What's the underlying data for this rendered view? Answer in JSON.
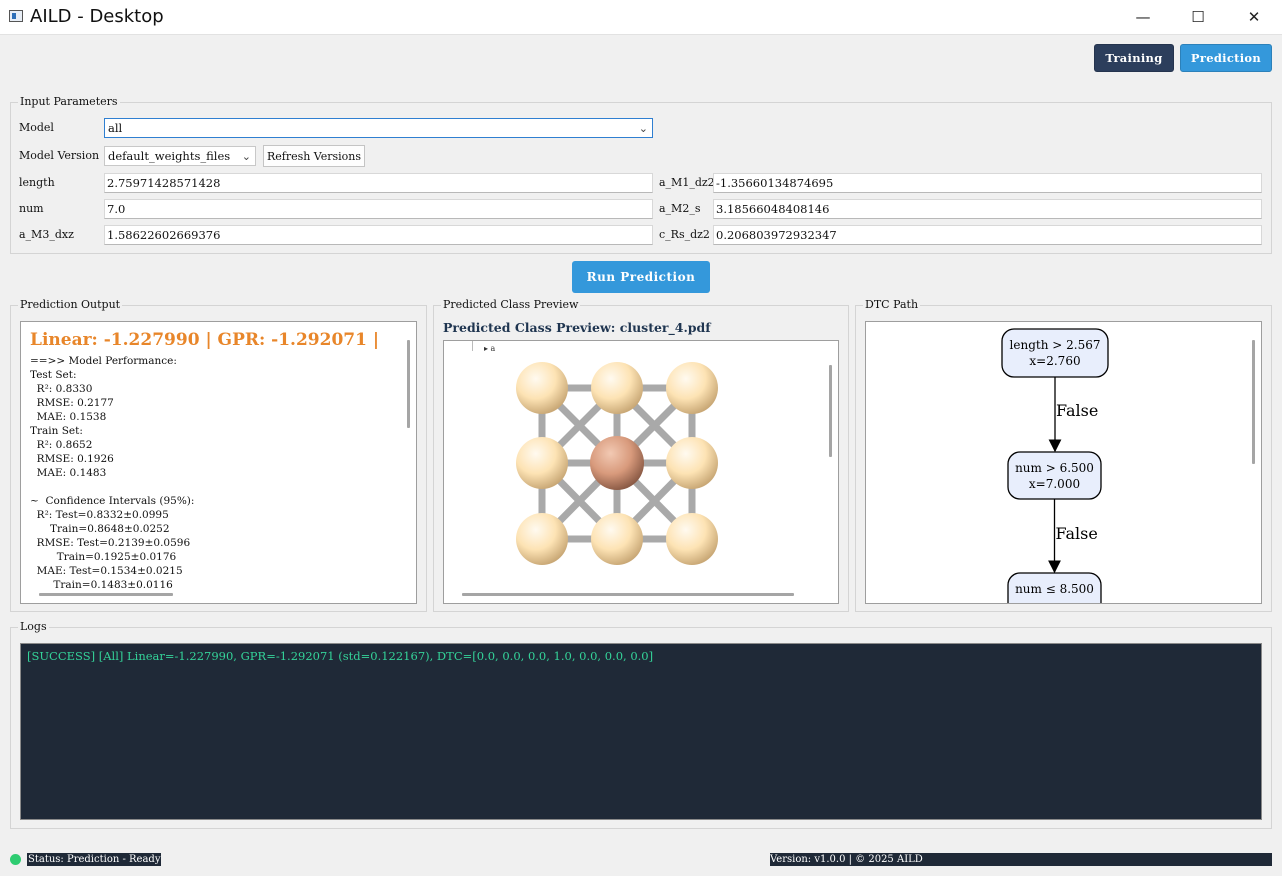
{
  "window": {
    "title": "AILD - Desktop",
    "minimize": "—",
    "maximize": "☐",
    "close": "✕"
  },
  "nav": {
    "training": "Training",
    "prediction": "Prediction",
    "training_color": "#2c3e5c",
    "prediction_color": "#3498db"
  },
  "input": {
    "group_title": "Input Parameters",
    "model_label": "Model",
    "model_value": "all",
    "version_label": "Model Version",
    "version_value": "default_weights_files",
    "refresh_label": "Refresh Versions",
    "fields": [
      {
        "label": "length",
        "value": "2.75971428571428"
      },
      {
        "label": "a_M1_dz2",
        "value": "-1.35660134874695"
      },
      {
        "label": "num",
        "value": "7.0"
      },
      {
        "label": "a_M2_s",
        "value": "3.18566048408146"
      },
      {
        "label": "a_M3_dxz",
        "value": "1.58622602669376"
      },
      {
        "label": "c_Rs_dz2",
        "value": "0.206803972932347"
      }
    ]
  },
  "run_label": "Run Prediction",
  "output": {
    "group_title": "Prediction Output",
    "headline": "Linear: -1.227990 | GPR: -1.292071 |",
    "headline_color": "#e8862a",
    "lines": [
      "==>> Model Performance:",
      "Test Set:",
      "  R²: 0.8330",
      "  RMSE: 0.2177",
      "  MAE: 0.1538",
      "Train Set:",
      "  R²: 0.8652",
      "  RMSE: 0.1926",
      "  MAE: 0.1483",
      "",
      "~  Confidence Intervals (95%):",
      "  R²: Test=0.8332±0.0995",
      "      Train=0.8648±0.0252",
      "  RMSE: Test=0.2139±0.0596",
      "        Train=0.1925±0.0176",
      "  MAE: Test=0.1534±0.0215",
      "       Train=0.1483±0.0116"
    ]
  },
  "preview": {
    "group_title": "Predicted Class Preview",
    "heading": "Predicted Class Preview: cluster_4.pdf",
    "axis_label": "▸ a",
    "atom_outer_color": "#fde3b4",
    "atom_center_color": "#d89a7c"
  },
  "dtc": {
    "group_title": "DTC Path",
    "nodes": [
      {
        "line1": "length > 2.567",
        "line2": "x=2.760"
      },
      {
        "line1": "num > 6.500",
        "line2": "x=7.000"
      },
      {
        "line1": "num ≤ 8.500",
        "line2": ""
      }
    ],
    "edges": [
      "False",
      "False"
    ],
    "node_fill": "#e8eefc"
  },
  "logs": {
    "group_title": "Logs",
    "entries": [
      "[SUCCESS] [All] Linear=-1.227990, GPR=-1.292071 (std=0.122167), DTC=[0.0, 0.0, 0.0, 1.0, 0.0, 0.0, 0.0]"
    ],
    "text_color": "#34d399"
  },
  "status": {
    "text": "Status: Prediction - Ready",
    "indicator_color": "#2ecc71",
    "version": "Version: v1.0.0 | © 2025 AILD"
  }
}
